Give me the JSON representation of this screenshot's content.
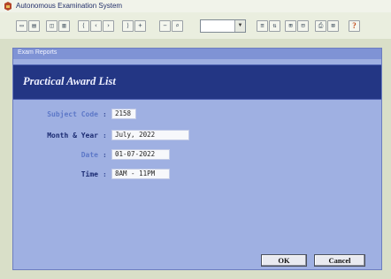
{
  "app": {
    "title": "Autonomous Examination System"
  },
  "toolbar": {
    "buttons": [
      {
        "name": "new-button",
        "glyph": "▭"
      },
      {
        "name": "open-button",
        "glyph": "▤"
      },
      {
        "name": "save-button",
        "glyph": "◫"
      },
      {
        "name": "edit-button",
        "glyph": "▥"
      },
      {
        "name": "first-button",
        "glyph": "⟨"
      },
      {
        "name": "prev-button",
        "glyph": "‹"
      },
      {
        "name": "next-button",
        "glyph": "›"
      },
      {
        "name": "last-button",
        "glyph": "⟩"
      },
      {
        "name": "add-button",
        "glyph": "+"
      },
      {
        "name": "delete-button",
        "glyph": "−"
      },
      {
        "name": "find-button",
        "glyph": "⌕"
      },
      {
        "name": "print-button",
        "glyph": "⎙"
      }
    ],
    "help_label": "?"
  },
  "window": {
    "title": "Exam Reports",
    "banner_title": "Practical Award List"
  },
  "form": {
    "subject_code": {
      "label": "Subject Code",
      "value": "2158"
    },
    "month_year": {
      "label": "Month & Year",
      "value": "July, 2022"
    },
    "date": {
      "label": "Date",
      "value": "01-07-2022"
    },
    "time": {
      "label": "Time",
      "value": "8AM - 11PM"
    },
    "colon": ":"
  },
  "actions": {
    "ok_label": "OK",
    "cancel_label": "Cancel"
  },
  "colors": {
    "banner": "#233684",
    "window": "#9fb0e2",
    "background": "#d9dfc8"
  }
}
